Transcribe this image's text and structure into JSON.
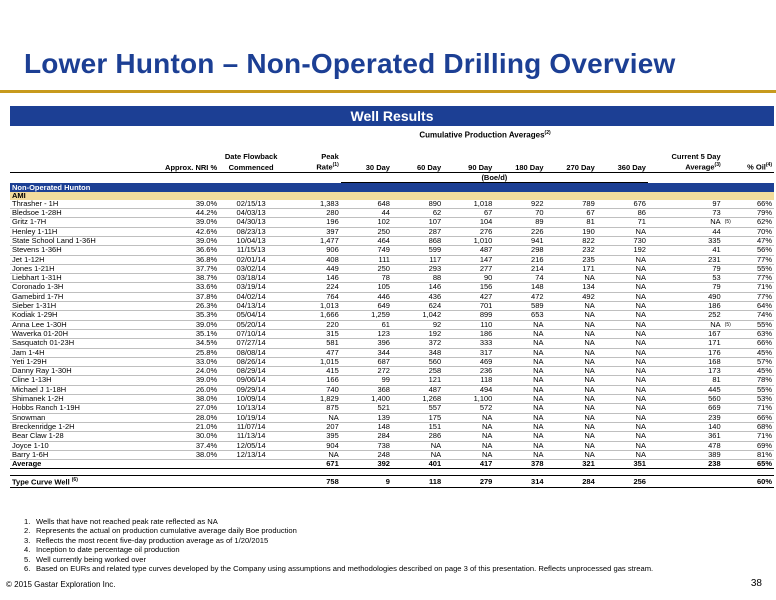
{
  "title": "Lower Hunton – Non-Operated Drilling Overview",
  "banner": "Well Results",
  "cum_header": "Cumulative Production Averages",
  "cum_header_sup": "(2)",
  "headers": {
    "nri": "Approx. NRI %",
    "date1": "Date Flowback",
    "date2": "Commenced",
    "peak1": "Peak",
    "peak2": "Rate",
    "peak_sup": "(1)",
    "d30": "30 Day",
    "d60": "60 Day",
    "d90": "90 Day",
    "d180": "180 Day",
    "d270": "270 Day",
    "d360": "360 Day",
    "cur1": "Current 5 Day",
    "cur2": "Average",
    "cur_sup": "(3)",
    "oil": "% Oil",
    "oil_sup": "(4)",
    "units": "(Boe/d)"
  },
  "section_label": "Non-Operated Hunton",
  "ami_label": "AMI",
  "wells": [
    [
      "Thrasher - 1H",
      "39.0%",
      "02/15/13",
      "1,383",
      "648",
      "890",
      "1,018",
      "922",
      "789",
      "676",
      "97",
      "",
      "66%"
    ],
    [
      "Bledsoe 1-28H",
      "44.2%",
      "04/03/13",
      "280",
      "44",
      "62",
      "67",
      "70",
      "67",
      "86",
      "73",
      "",
      "79%"
    ],
    [
      "Gritz 1-7H",
      "39.0%",
      "04/30/13",
      "196",
      "102",
      "107",
      "104",
      "89",
      "81",
      "71",
      "NA",
      "(5)",
      "62%"
    ],
    [
      "Henley 1-11H",
      "42.6%",
      "08/23/13",
      "397",
      "250",
      "287",
      "276",
      "226",
      "190",
      "NA",
      "44",
      "",
      "70%"
    ],
    [
      "State School Land 1-36H",
      "39.0%",
      "10/04/13",
      "1,477",
      "464",
      "868",
      "1,010",
      "941",
      "822",
      "730",
      "335",
      "",
      "47%"
    ],
    [
      "Stevens 1-36H",
      "36.6%",
      "11/15/13",
      "906",
      "749",
      "599",
      "487",
      "298",
      "232",
      "192",
      "41",
      "",
      "56%"
    ],
    [
      "Jet 1-12H",
      "36.8%",
      "02/01/14",
      "408",
      "111",
      "117",
      "147",
      "216",
      "235",
      "NA",
      "231",
      "",
      "77%"
    ],
    [
      "Jones 1-21H",
      "37.7%",
      "03/02/14",
      "449",
      "250",
      "293",
      "277",
      "214",
      "171",
      "NA",
      "79",
      "",
      "55%"
    ],
    [
      "Liebhart 1-31H",
      "38.7%",
      "03/18/14",
      "146",
      "78",
      "88",
      "90",
      "74",
      "NA",
      "NA",
      "53",
      "",
      "77%"
    ],
    [
      "Coronado 1-3H",
      "33.6%",
      "03/19/14",
      "224",
      "105",
      "146",
      "156",
      "148",
      "134",
      "NA",
      "79",
      "",
      "71%"
    ],
    [
      "Gamebird 1-7H",
      "37.8%",
      "04/02/14",
      "764",
      "446",
      "436",
      "427",
      "472",
      "492",
      "NA",
      "490",
      "",
      "77%"
    ],
    [
      "Sieber 1-31H",
      "26.3%",
      "04/13/14",
      "1,013",
      "649",
      "624",
      "701",
      "589",
      "NA",
      "NA",
      "186",
      "",
      "64%"
    ],
    [
      "Kodiak 1-29H",
      "35.3%",
      "05/04/14",
      "1,666",
      "1,259",
      "1,042",
      "899",
      "653",
      "NA",
      "NA",
      "252",
      "",
      "74%"
    ],
    [
      "Anna Lee 1-30H",
      "39.0%",
      "05/20/14",
      "220",
      "61",
      "92",
      "110",
      "NA",
      "NA",
      "NA",
      "NA",
      "(5)",
      "55%"
    ],
    [
      "Waverka 01-20H",
      "35.1%",
      "07/10/14",
      "315",
      "123",
      "192",
      "186",
      "NA",
      "NA",
      "NA",
      "167",
      "",
      "63%"
    ],
    [
      "Sasquatch 01-23H",
      "34.5%",
      "07/27/14",
      "581",
      "396",
      "372",
      "333",
      "NA",
      "NA",
      "NA",
      "171",
      "",
      "66%"
    ],
    [
      "Jam 1-4H",
      "25.8%",
      "08/08/14",
      "477",
      "344",
      "348",
      "317",
      "NA",
      "NA",
      "NA",
      "176",
      "",
      "45%"
    ],
    [
      "Yeti 1-29H",
      "33.0%",
      "08/26/14",
      "1,015",
      "687",
      "560",
      "469",
      "NA",
      "NA",
      "NA",
      "168",
      "",
      "57%"
    ],
    [
      "Danny Ray 1-30H",
      "24.0%",
      "08/29/14",
      "415",
      "272",
      "258",
      "236",
      "NA",
      "NA",
      "NA",
      "173",
      "",
      "45%"
    ],
    [
      "Cline 1-13H",
      "39.0%",
      "09/06/14",
      "166",
      "99",
      "121",
      "118",
      "NA",
      "NA",
      "NA",
      "81",
      "",
      "78%"
    ],
    [
      "Michael J 1-18H",
      "26.0%",
      "09/29/14",
      "740",
      "368",
      "487",
      "494",
      "NA",
      "NA",
      "NA",
      "445",
      "",
      "55%"
    ],
    [
      "Shimanek 1-2H",
      "38.0%",
      "10/09/14",
      "1,829",
      "1,400",
      "1,268",
      "1,100",
      "NA",
      "NA",
      "NA",
      "560",
      "",
      "53%"
    ],
    [
      "Hobbs Ranch 1-19H",
      "27.0%",
      "10/13/14",
      "875",
      "521",
      "557",
      "572",
      "NA",
      "NA",
      "NA",
      "669",
      "",
      "71%"
    ],
    [
      "Snowman",
      "28.0%",
      "10/19/14",
      "NA",
      "139",
      "175",
      "NA",
      "NA",
      "NA",
      "NA",
      "239",
      "",
      "66%"
    ],
    [
      "Breckenridge 1-2H",
      "21.0%",
      "11/07/14",
      "207",
      "148",
      "151",
      "NA",
      "NA",
      "NA",
      "NA",
      "140",
      "",
      "68%"
    ],
    [
      "Bear Claw 1-28",
      "30.0%",
      "11/13/14",
      "395",
      "284",
      "286",
      "NA",
      "NA",
      "NA",
      "NA",
      "361",
      "",
      "71%"
    ],
    [
      "Joyce 1-10",
      "37.4%",
      "12/05/14",
      "904",
      "738",
      "NA",
      "NA",
      "NA",
      "NA",
      "NA",
      "478",
      "",
      "69%"
    ],
    [
      "Barry 1-6H",
      "38.0%",
      "12/13/14",
      "NA",
      "248",
      "NA",
      "NA",
      "NA",
      "NA",
      "NA",
      "389",
      "",
      "81%"
    ]
  ],
  "average": [
    "Average",
    "",
    "",
    "671",
    "392",
    "401",
    "417",
    "378",
    "321",
    "351",
    "238",
    "",
    "65%"
  ],
  "type_curve": [
    "Type Curve Well",
    "",
    "",
    "758",
    "9",
    "118",
    "279",
    "314",
    "284",
    "256",
    "",
    "",
    "60%"
  ],
  "type_curve_sup": "(6)",
  "footnotes": [
    "Wells that have not reached peak rate reflected as NA",
    "Represents the actual on production cumulative average daily Boe production",
    "Reflects the most recent five-day production average as of 1/20/2015",
    "Inception to date percentage oil production",
    "Well currently being worked over",
    "Based on EURs and related type curves developed by the Company using assumptions and methodologies described on page 3 of this presentation. Reflects unprocessed gas stream."
  ],
  "footnote_nums": [
    "1.",
    "2.",
    "3.",
    "4.",
    "5.",
    "6."
  ],
  "copyright": "© 2015 Gastar Exploration Inc.",
  "page_number": "38",
  "colors": {
    "title_blue": "#1c3f94",
    "gold_rule": "#c79a1d",
    "ami_fill": "#f2dc9d"
  }
}
